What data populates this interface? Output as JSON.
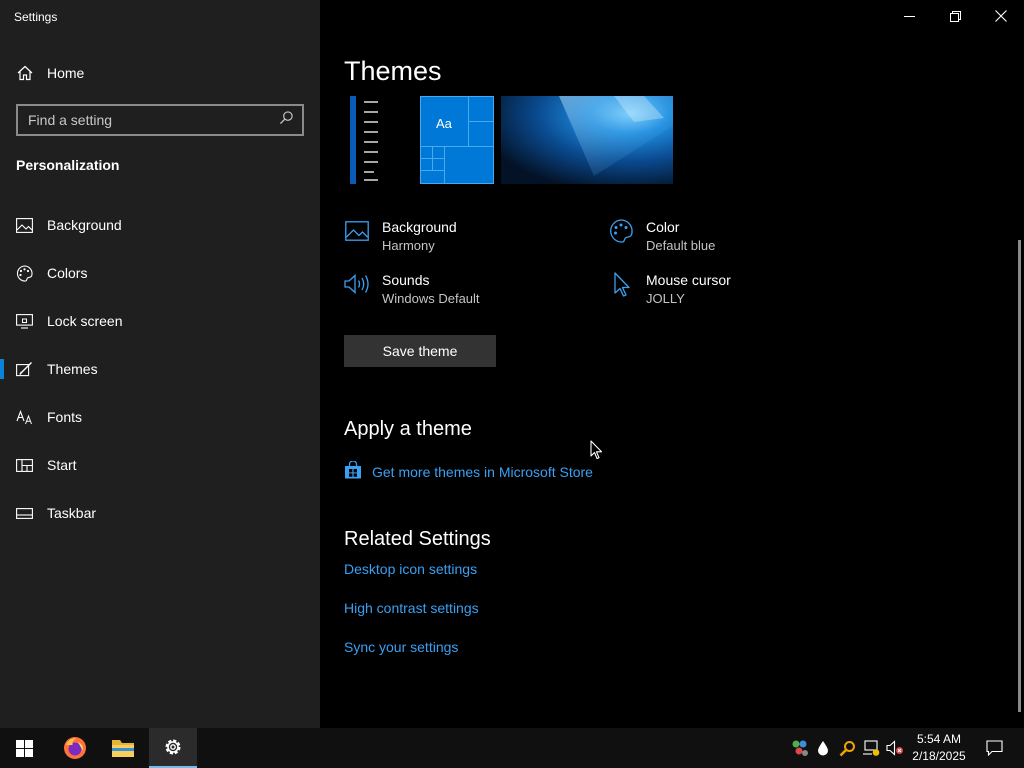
{
  "window": {
    "title": "Settings"
  },
  "sidebar": {
    "home_label": "Home",
    "search_placeholder": "Find a setting",
    "section_title": "Personalization",
    "items": [
      {
        "label": "Background",
        "icon": "picture-icon"
      },
      {
        "label": "Colors",
        "icon": "palette-icon"
      },
      {
        "label": "Lock screen",
        "icon": "lock-screen-icon"
      },
      {
        "label": "Themes",
        "icon": "themes-icon",
        "active": true
      },
      {
        "label": "Fonts",
        "icon": "fonts-icon"
      },
      {
        "label": "Start",
        "icon": "start-icon"
      },
      {
        "label": "Taskbar",
        "icon": "taskbar-icon"
      }
    ]
  },
  "main": {
    "title": "Themes",
    "preview_sample_text": "Aa",
    "options": [
      {
        "label": "Background",
        "value": "Harmony",
        "icon": "picture-icon"
      },
      {
        "label": "Color",
        "value": "Default blue",
        "icon": "palette-icon"
      },
      {
        "label": "Sounds",
        "value": "Windows Default",
        "icon": "speaker-icon"
      },
      {
        "label": "Mouse cursor",
        "value": "JOLLY",
        "icon": "cursor-icon"
      }
    ],
    "save_button": "Save theme",
    "apply_title": "Apply a theme",
    "store_link": "Get more themes in Microsoft Store",
    "related_title": "Related Settings",
    "related_links": [
      "Desktop icon settings",
      "High contrast settings",
      "Sync your settings"
    ]
  },
  "taskbar": {
    "time": "5:54 AM",
    "date": "2/18/2025",
    "apps": [
      "start-icon",
      "firefox-icon",
      "file-explorer-icon",
      "settings-icon"
    ]
  },
  "colors": {
    "accent": "#0078d7",
    "link": "#3aa0f3",
    "sidebar_bg": "#1f1f1f",
    "main_bg": "#000000"
  }
}
